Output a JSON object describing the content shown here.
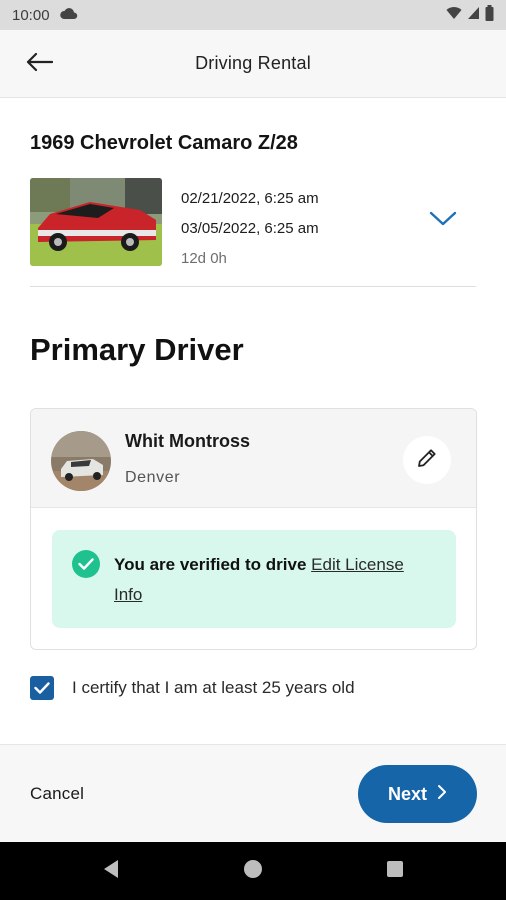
{
  "status_bar": {
    "time": "10:00",
    "icons": [
      "cloud-icon",
      "wifi-icon",
      "signal-icon",
      "battery-icon"
    ]
  },
  "app_bar": {
    "title": "Driving Rental",
    "back_icon": "arrow-left-icon"
  },
  "rental": {
    "car_name": "1969 Chevrolet Camaro Z/28",
    "start_date": "02/21/2022",
    "start_time": ", 6:25 am",
    "end_date": "03/05/2022",
    "end_time": ", 6:25 am",
    "duration": "12d 0h",
    "expand_icon": "chevron-down-icon"
  },
  "primary_driver": {
    "section_title": "Primary Driver",
    "name": "Whit Montross",
    "city": "Denver",
    "edit_icon": "pencil-icon",
    "verified_text": "You are verified to drive",
    "edit_license_link": "Edit License Info"
  },
  "certify": {
    "checked": true,
    "label": "I certify that I am at least 25 years old"
  },
  "footer": {
    "cancel_label": "Cancel",
    "next_label": "Next"
  },
  "colors": {
    "primary": "#1565a8",
    "verified_bg": "#d8f8ee",
    "verified_check": "#1fc28e",
    "chevron": "#1e70b8"
  }
}
